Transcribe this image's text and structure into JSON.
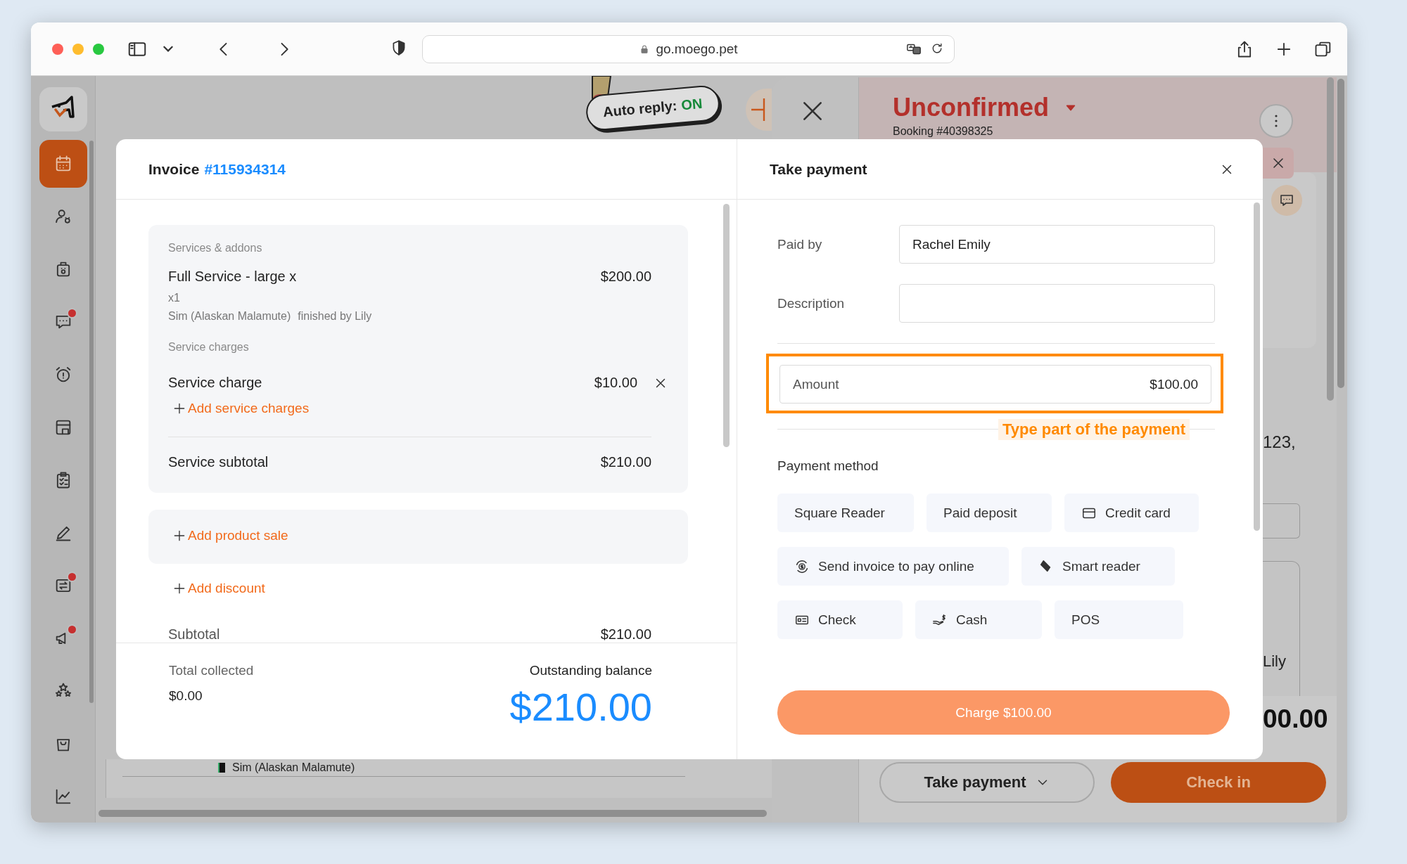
{
  "browser": {
    "url": "go.moego.pet"
  },
  "nav_rail": {
    "items": [
      {
        "selected": true,
        "notification": false
      },
      {
        "selected": false,
        "notification": false
      },
      {
        "selected": false,
        "notification": false
      },
      {
        "selected": false,
        "notification": true
      },
      {
        "selected": false,
        "notification": false
      },
      {
        "selected": false,
        "notification": false
      },
      {
        "selected": false,
        "notification": false
      },
      {
        "selected": false,
        "notification": false
      },
      {
        "selected": false,
        "notification": true
      },
      {
        "selected": false,
        "notification": true
      },
      {
        "selected": false,
        "notification": false
      },
      {
        "selected": false,
        "notification": false
      },
      {
        "selected": false,
        "notification": false
      }
    ]
  },
  "auto_reply": {
    "label": "Auto reply:",
    "status": "ON"
  },
  "appointment": {
    "status": "Unconfirmed",
    "booking": "Booking #40398325",
    "address_fragment": "123,",
    "staff_fragment": "Lily",
    "total_fragment": "00.00",
    "take_payment_button": "Take payment",
    "check_in_button": "Check in",
    "pet_row": "Sim (Alaskan Malamute)"
  },
  "invoice": {
    "title": "Invoice",
    "number": "#115934314",
    "services_heading": "Services & addons",
    "service": {
      "name": "Full Service - large x",
      "price": "$200.00",
      "quantity": "x1",
      "pet": "Sim (Alaskan Malamute)",
      "staff": "finished by Lily"
    },
    "charges_heading": "Service charges",
    "charge": {
      "name": "Service charge",
      "price": "$10.00"
    },
    "add_service_charges": "Add service charges",
    "service_subtotal": {
      "label": "Service subtotal",
      "value": "$210.00"
    },
    "add_product_sale": "Add product sale",
    "add_discount": "Add discount",
    "subtotal": {
      "label": "Subtotal",
      "value": "$210.00"
    },
    "total_collected": {
      "label": "Total collected",
      "value": "$0.00"
    },
    "outstanding": {
      "label": "Outstanding balance",
      "value": "$210.00"
    }
  },
  "payment": {
    "title": "Take payment",
    "fields": [
      {
        "label": "Paid by",
        "value": "Rachel Emily"
      },
      {
        "label": "Description"
      }
    ],
    "amount": {
      "label": "Amount",
      "value": "$100.00",
      "highlighted": true
    },
    "annotation": "Type part of the payment",
    "method_label": "Payment method",
    "methods": [
      {
        "label": "Square Reader",
        "selected": false
      },
      {
        "label": "Paid deposit",
        "selected": false
      },
      {
        "label": "Credit card",
        "selected": false
      },
      {
        "label": "Send invoice to pay online",
        "selected": false
      },
      {
        "label": "Smart reader",
        "selected": false
      },
      {
        "label": "Check",
        "selected": false
      },
      {
        "label": "Cash",
        "selected": false
      },
      {
        "label": "POS",
        "selected": false
      }
    ],
    "charge_button": "Charge $100.00"
  }
}
